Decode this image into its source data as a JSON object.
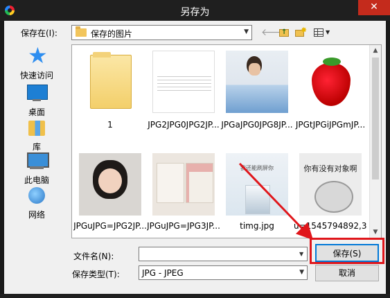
{
  "window": {
    "title": "另存为",
    "close_label": "✕"
  },
  "toolbar": {
    "look_in_label": "保存在(I):",
    "look_in_value": "保存的图片",
    "back_icon": "arrow-left-icon",
    "up_icon": "up-folder-icon",
    "new_folder_icon": "new-folder-icon",
    "view_icon": "view-menu-icon"
  },
  "places": [
    {
      "label": "快速访问",
      "icon": "star-icon"
    },
    {
      "label": "桌面",
      "icon": "desktop-icon"
    },
    {
      "label": "库",
      "icon": "library-icon"
    },
    {
      "label": "此电脑",
      "icon": "computer-icon"
    },
    {
      "label": "网络",
      "icon": "network-icon"
    }
  ],
  "files": [
    {
      "name": "1",
      "kind": "folder"
    },
    {
      "name": "JPG2JPG0JPG2JP...",
      "kind": "image"
    },
    {
      "name": "JPGaJPG0JPG8JP...",
      "kind": "image"
    },
    {
      "name": "JPGtJPGiJPGmJP...",
      "kind": "image"
    },
    {
      "name": "JPGuJPG=JPG2JP...",
      "kind": "image"
    },
    {
      "name": "JPGuJPG=JPG3JP...",
      "kind": "image"
    },
    {
      "name": "timg.jpg",
      "kind": "image",
      "caption": "我还能刷屏你"
    },
    {
      "name": "u=1545794892,3...",
      "kind": "image",
      "caption": "你有没有对象啊"
    }
  ],
  "form": {
    "filename_label": "文件名(N):",
    "filename_value": "",
    "filetype_label": "保存类型(T):",
    "filetype_value": "JPG - JPEG",
    "save_label": "保存(S)",
    "cancel_label": "取消"
  },
  "colors": {
    "highlight": "#e0161b",
    "titlebar": "#1f1f1f",
    "close": "#c42b1c"
  }
}
